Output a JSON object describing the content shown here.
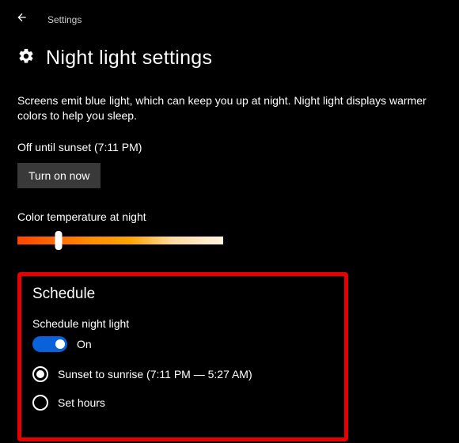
{
  "header": {
    "app_title": "Settings"
  },
  "page": {
    "title": "Night light settings",
    "description": "Screens emit blue light, which can keep you up at night. Night light displays warmer colors to help you sleep.",
    "status": "Off until sunset (7:11 PM)",
    "turn_on_label": "Turn on now",
    "slider": {
      "label": "Color temperature at night",
      "value_percent": 20
    }
  },
  "schedule": {
    "title": "Schedule",
    "label": "Schedule night light",
    "toggle": {
      "state": "on",
      "text": "On"
    },
    "options": [
      {
        "label": "Sunset to sunrise (7:11 PM — 5:27 AM)",
        "selected": true
      },
      {
        "label": "Set hours",
        "selected": false
      }
    ]
  }
}
